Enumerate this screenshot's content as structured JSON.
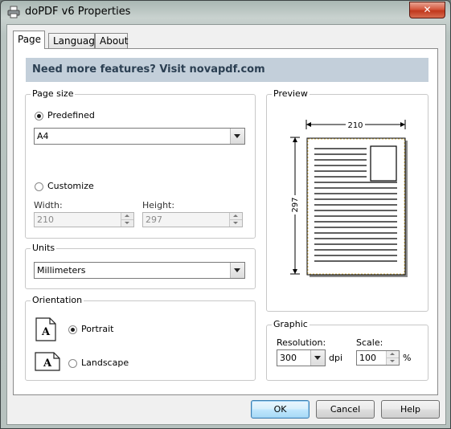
{
  "window": {
    "title": "doPDF v6 Properties",
    "close_label": "✕"
  },
  "tabs": [
    {
      "label": "Page"
    },
    {
      "label": "Language"
    },
    {
      "label": "About"
    }
  ],
  "banner": {
    "text": "Need more features? Visit novapdf.com"
  },
  "page_size": {
    "group_label": "Page size",
    "predefined_label": "Predefined",
    "predefined_selected": true,
    "paper": "A4",
    "customize_label": "Customize",
    "width_label": "Width:",
    "width_value": "210",
    "height_label": "Height:",
    "height_value": "297"
  },
  "preview": {
    "group_label": "Preview",
    "width_text": "210",
    "height_text": "297"
  },
  "units": {
    "group_label": "Units",
    "value": "Millimeters"
  },
  "orientation": {
    "group_label": "Orientation",
    "portrait_label": "Portrait",
    "landscape_label": "Landscape",
    "portrait_selected": true,
    "icon_letter": "A"
  },
  "graphic": {
    "group_label": "Graphic",
    "resolution_label": "Resolution:",
    "resolution_value": "300",
    "resolution_unit": "dpi",
    "scale_label": "Scale:",
    "scale_value": "100",
    "scale_unit": "%"
  },
  "buttons": {
    "ok": "OK",
    "cancel": "Cancel",
    "help": "Help"
  },
  "colors": {
    "banner_bg": "#c3cfda",
    "banner_text": "#2b3f52",
    "close_red": "#c0381c"
  }
}
